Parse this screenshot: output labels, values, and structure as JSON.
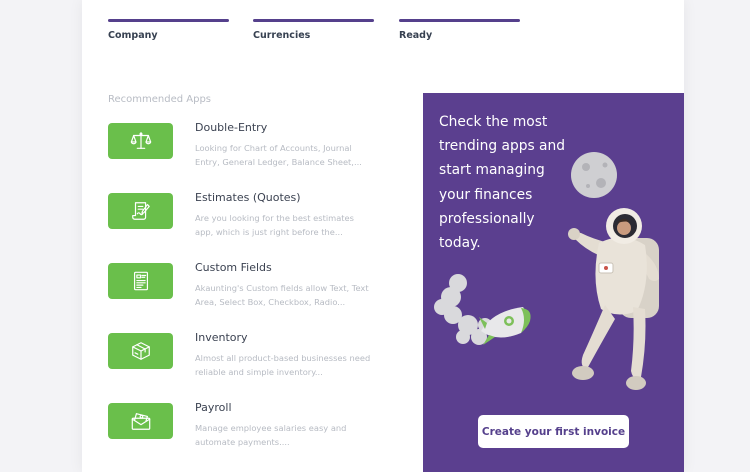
{
  "steps": [
    {
      "label": "Company"
    },
    {
      "label": "Currencies"
    },
    {
      "label": "Ready"
    }
  ],
  "recommended": {
    "title": "Recommended Apps",
    "apps": [
      {
        "name": "Double-Entry",
        "description": "Looking for Chart of Accounts, Journal Entry, General Ledger, Balance Sheet,...",
        "icon": "scales-icon"
      },
      {
        "name": "Estimates (Quotes)",
        "description": "Are you looking for the best estimates app, which is just right before the...",
        "icon": "document-sign-icon"
      },
      {
        "name": "Custom Fields",
        "description": "Akaunting's Custom fields allow Text, Text Area, Select Box, Checkbox, Radio...",
        "icon": "form-icon"
      },
      {
        "name": "Inventory",
        "description": "Almost all product-based businesses need reliable and simple inventory...",
        "icon": "box-icon"
      },
      {
        "name": "Payroll",
        "description": "Manage employee salaries easy and automate payments....",
        "icon": "envelope-money-icon"
      }
    ]
  },
  "promo": {
    "text": "Check the most trending apps and start managing your finances professionally today.",
    "button_label": "Create your first invoice"
  },
  "colors": {
    "accent": "#55408c",
    "promo_bg": "#5b3f8f",
    "app_tile": "#6abf4b"
  }
}
